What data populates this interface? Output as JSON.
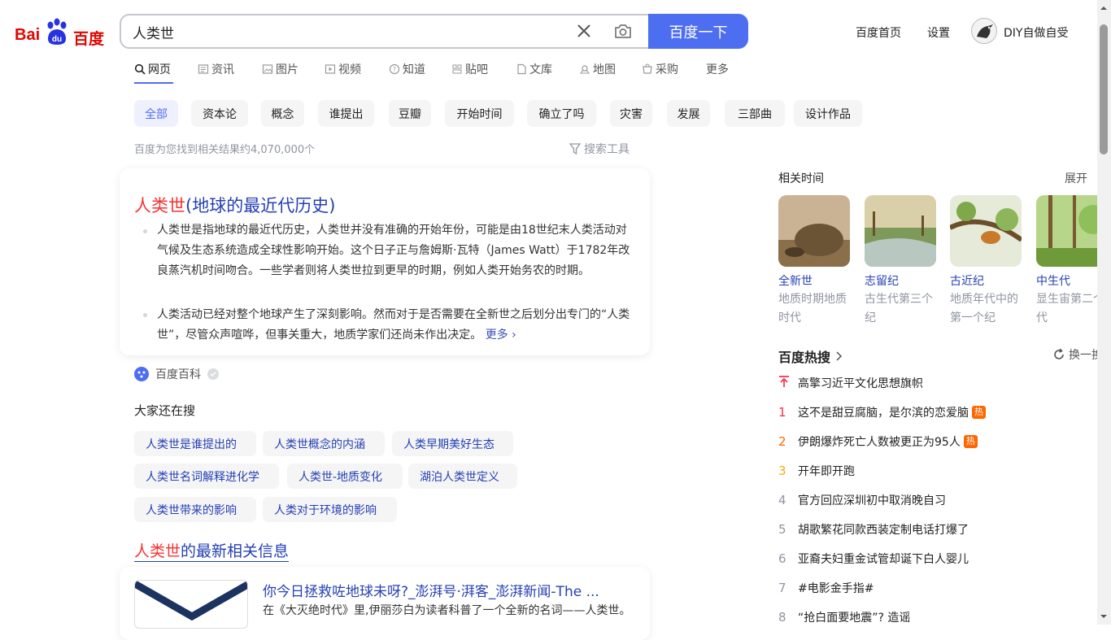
{
  "logo": {
    "text_left": "Bai",
    "text_paw": "du",
    "text_right": "百度"
  },
  "search": {
    "query": "人类世",
    "button_label": "百度一下"
  },
  "header": {
    "home_link": "百度首页",
    "settings_link": "设置",
    "username": "DIY自做自受"
  },
  "nav_tabs": [
    {
      "label": "网页",
      "icon": "search-icon"
    },
    {
      "label": "资讯",
      "icon": "news-icon"
    },
    {
      "label": "图片",
      "icon": "image-icon"
    },
    {
      "label": "视频",
      "icon": "video-icon"
    },
    {
      "label": "知道",
      "icon": "question-icon"
    },
    {
      "label": "贴吧",
      "icon": "tieba-icon"
    },
    {
      "label": "文库",
      "icon": "doc-icon"
    },
    {
      "label": "地图",
      "icon": "map-icon"
    },
    {
      "label": "采购",
      "icon": "cart-icon"
    },
    {
      "label": "更多",
      "icon": ""
    }
  ],
  "filter_chips": [
    "全部",
    "资本论",
    "概念",
    "谁提出",
    "豆瓣",
    "开始时间",
    "确立了吗",
    "灾害",
    "发展",
    "三部曲",
    "设计作品"
  ],
  "result_count": "百度为您找到相关结果约4,070,000个",
  "search_tools": "搜索工具",
  "result1": {
    "title_highlight": "人类世",
    "title_rest": "(地球的最近代历史)",
    "para1": "人类世是指地球的最近代历史，人类世并没有准确的开始年份，可能是由18世纪末人类活动对气候及生态系统造成全球性影响开始。这个日子正与詹姆斯·瓦特（James Watt）于1782年改良蒸汽机时间吻合。一些学者则将人类世拉到更早的时期，例如人类开始务农的时期。",
    "para2": "人类活动已经对整个地球产生了深刻影响。然而对于是否需要在全新世之后划分出专门的“人类世”，尽管众声喧哗，但事关重大，地质学家们还尚未作出决定。",
    "more": "更多",
    "source": "百度百科"
  },
  "related_search": {
    "heading": "大家还在搜",
    "items": [
      [
        "人类世是谁提出的",
        "人类世概念的内涵",
        "人类早期美好生态"
      ],
      [
        "人类世名词解释进化学",
        "人类世-地质变化",
        "湖泊人类世定义"
      ],
      [
        "人类世带来的影响",
        "人类对于环境的影响"
      ]
    ]
  },
  "news": {
    "heading_highlight": "人类世",
    "heading_rest": "的最新相关信息",
    "item_title": "你今日拯救咗地球未呀?_澎湃号·湃客_澎湃新闻-The ...",
    "item_desc": "在《大灭绝时代》里,伊丽莎白为读者科普了一个全新的名词——人类世。"
  },
  "related_time": {
    "heading": "相关时间",
    "expand": "展开",
    "items": [
      {
        "name": "全新世",
        "desc": "地质时期地质时代"
      },
      {
        "name": "志留纪",
        "desc": "古生代第三个纪"
      },
      {
        "name": "古近纪",
        "desc": "地质年代中的第一个纪"
      },
      {
        "name": "中生代",
        "desc": "显生宙第二个代"
      }
    ]
  },
  "hot": {
    "heading": "百度热搜",
    "refresh": "换一换",
    "items": [
      {
        "rank": "",
        "title": "高擎习近平文化思想旗帜",
        "badge": "",
        "pinned": true
      },
      {
        "rank": "1",
        "title": "这不是甜豆腐脑，是尔滨的恋爱脑",
        "badge": "热"
      },
      {
        "rank": "2",
        "title": "伊朗爆炸死亡人数被更正为95人",
        "badge": "热"
      },
      {
        "rank": "3",
        "title": "开年即开跑",
        "badge": ""
      },
      {
        "rank": "4",
        "title": "官方回应深圳初中取消晚自习",
        "badge": ""
      },
      {
        "rank": "5",
        "title": "胡歌繁花同款西装定制电话打爆了",
        "badge": ""
      },
      {
        "rank": "6",
        "title": "亚裔夫妇重金试管却诞下白人婴儿",
        "badge": ""
      },
      {
        "rank": "7",
        "title": "#电影金手指#",
        "badge": ""
      },
      {
        "rank": "8",
        "title": "“抢白面要地震”? 造谣",
        "badge": ""
      }
    ],
    "rank_colors": {
      "1": "#fe2d46",
      "2": "#f60",
      "3": "#faa90e",
      "other": "#9195a3"
    }
  }
}
